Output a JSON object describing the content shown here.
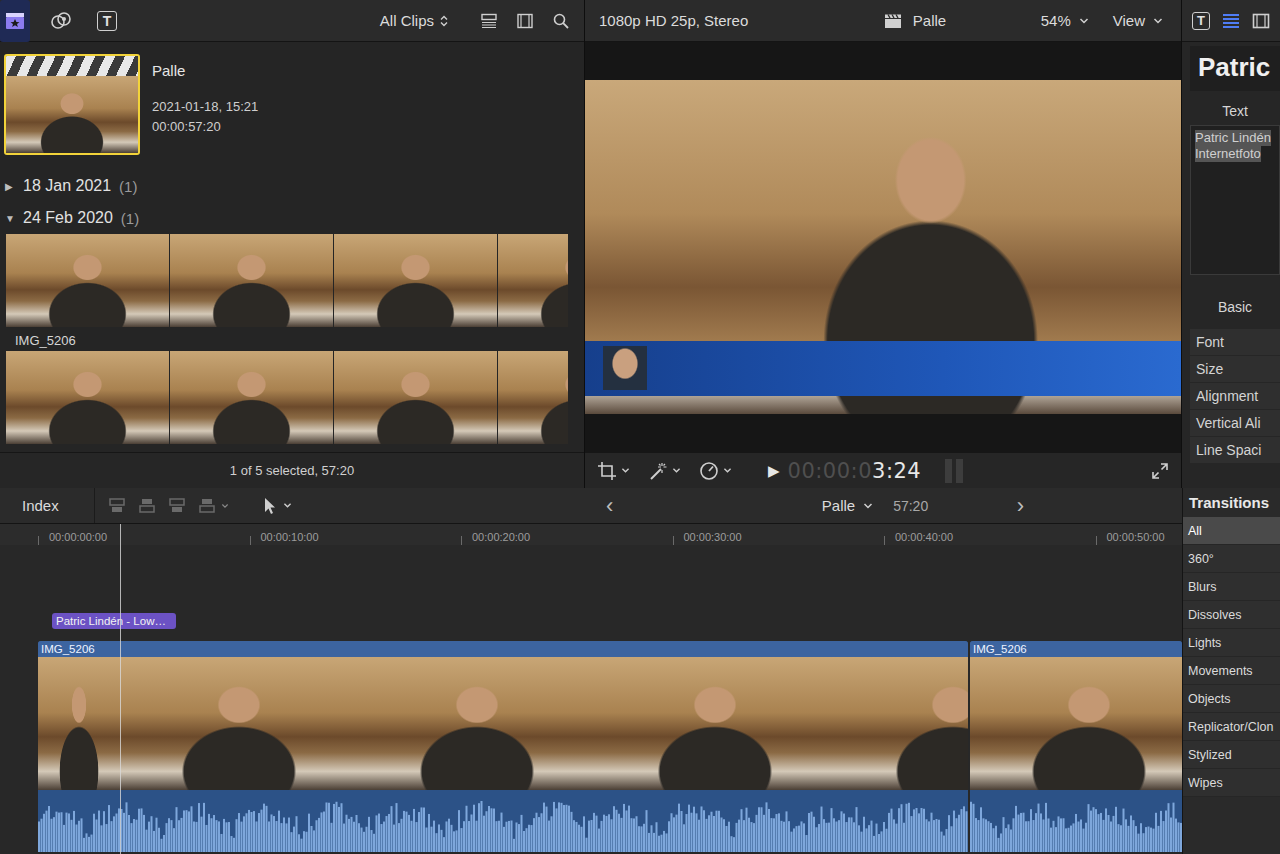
{
  "browser": {
    "tabs": [
      {
        "kind": "libraries",
        "selected": true
      },
      {
        "kind": "media",
        "selected": false
      },
      {
        "kind": "titles",
        "glyph": "T",
        "selected": false
      }
    ],
    "filter": "All Clips",
    "event_clip": {
      "name": "Palle",
      "date": "2021-01-18, 15:21",
      "duration": "00:00:57:20",
      "selected": true
    },
    "groups": [
      {
        "toggle": "▶",
        "label": "18 Jan 2021",
        "count": "(1)",
        "expanded": false,
        "filmstrips": []
      },
      {
        "toggle": "▼",
        "label": "24 Feb 2020",
        "count": "(1)",
        "expanded": true,
        "filmstrips": [
          {
            "label": "IMG_5206"
          },
          {
            "label": null
          }
        ]
      }
    ],
    "footer": "1 of 5 selected, 57:20"
  },
  "viewer": {
    "format": "1080p HD 25p, Stereo",
    "project": "Palle",
    "zoom": "54%",
    "view_menu": "View",
    "play": "▶",
    "timecode_dim": "00:00:0",
    "timecode_lit": "3:24"
  },
  "inspector": {
    "tabs": [
      {
        "kind": "title",
        "glyph": "T",
        "selected": false
      },
      {
        "kind": "text",
        "selected": true
      },
      {
        "kind": "video",
        "selected": false
      }
    ],
    "heading": "Patric",
    "text_label": "Text",
    "text_lines": [
      "Patric Lindén",
      "Internetfoto"
    ],
    "text_selected": true,
    "preset": "Basic",
    "properties": [
      "Font",
      "Size",
      "Alignment",
      "Vertical Ali",
      "Line Spaci"
    ]
  },
  "timeline": {
    "index": "Index",
    "prev": "‹",
    "next": "›",
    "project": "Palle",
    "duration": "57:20",
    "ruler": [
      "00:00:00:00",
      "00:00:10:00",
      "00:00:20:00",
      "00:00:30:00",
      "00:00:40:00",
      "00:00:50:00"
    ],
    "playhead_level": 0.072,
    "title_clip": "Patric Lindén - Low…",
    "clips": [
      {
        "name": "IMG_5206"
      },
      {
        "name": "IMG_5206"
      }
    ]
  },
  "transitions": {
    "title": "Transitions",
    "categories": [
      {
        "label": "All",
        "selected": true
      },
      {
        "label": "360°",
        "selected": false
      },
      {
        "label": "Blurs",
        "selected": false
      },
      {
        "label": "Dissolves",
        "selected": false
      },
      {
        "label": "Lights",
        "selected": false
      },
      {
        "label": "Movements",
        "selected": false
      },
      {
        "label": "Objects",
        "selected": false
      },
      {
        "label": "Replicator/Clon",
        "selected": false
      },
      {
        "label": "Stylized",
        "selected": false
      },
      {
        "label": "Wipes",
        "selected": false
      }
    ]
  }
}
